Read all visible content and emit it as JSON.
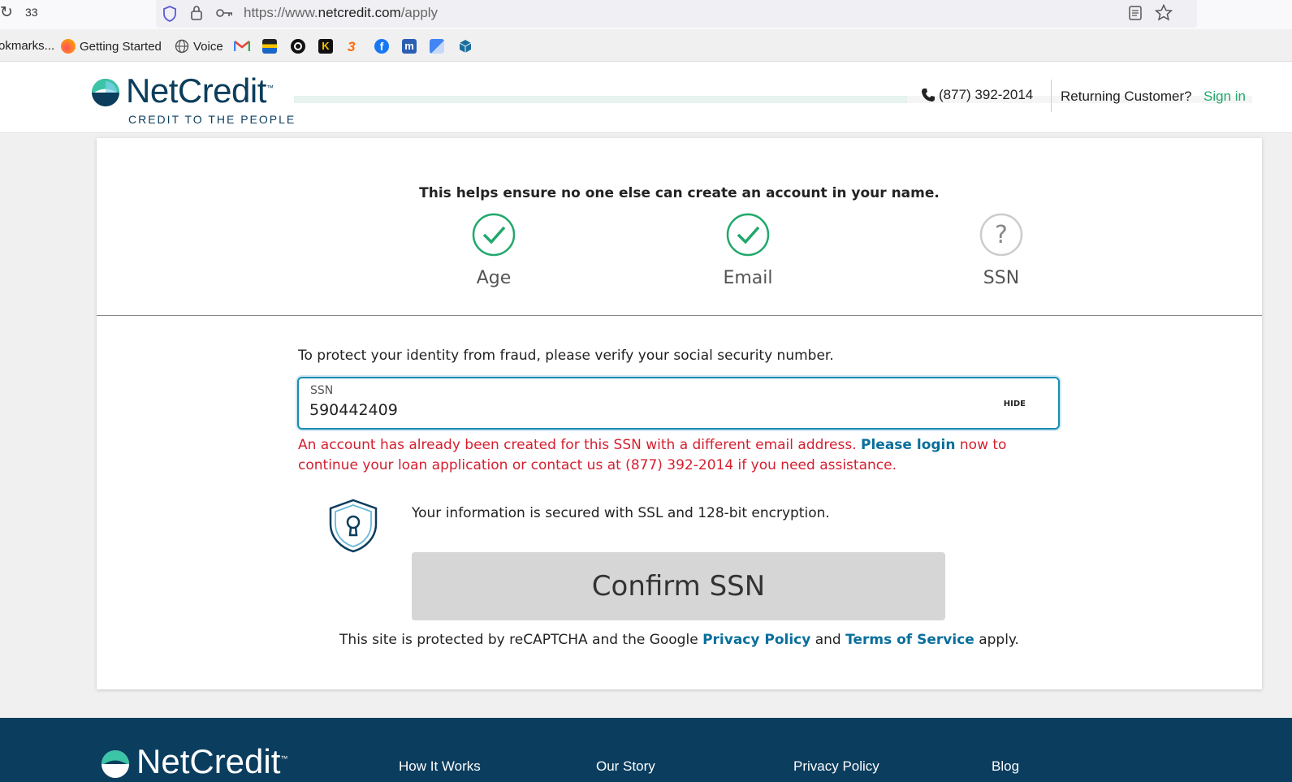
{
  "browser": {
    "tab_count": "33",
    "url_prefix": "https://www.",
    "url_domain": "netcredit.com",
    "url_path": "/apply",
    "bookmarks": [
      {
        "label": "okmarks..."
      },
      {
        "label": "Getting Started"
      },
      {
        "label": "Voice"
      }
    ]
  },
  "header": {
    "logo_text": "NetCredit",
    "logo_tm": "™",
    "tagline": "CREDIT TO THE PEOPLE",
    "progress_percent": 64,
    "phone": "(877) 392-2014",
    "returning_label": "Returning Customer?",
    "signin_label": "Sign in"
  },
  "card": {
    "headline": "This helps ensure no one else can create an account in your name.",
    "steps": [
      {
        "label": "Age",
        "status": "complete"
      },
      {
        "label": "Email",
        "status": "complete"
      },
      {
        "label": "SSN",
        "status": "pending"
      }
    ],
    "instruction": "To protect your identity from fraud, please verify your social security number.",
    "ssn_field": {
      "label": "SSN",
      "value": "590442409",
      "hide_label": "HIDE"
    },
    "error": {
      "before": "An account has already been created for this SSN with a different email address. ",
      "link": "Please login",
      "after": " now to continue your loan application or contact us at (877) 392-2014 if you need assistance."
    },
    "secure_text": "Your information is secured with SSL and 128-bit encryption.",
    "confirm_label": "Confirm SSN",
    "recaptcha": {
      "before": "This site is protected by reCAPTCHA and the Google ",
      "privacy": "Privacy Policy",
      "and": " and ",
      "terms": "Terms of Service",
      "after": " apply."
    }
  },
  "footer": {
    "logo_text": "NetCredit",
    "logo_tm": "™",
    "links": [
      "How It Works",
      "Our Story",
      "Privacy Policy",
      "Blog"
    ]
  },
  "colors": {
    "brand_navy": "#0b3d5c",
    "brand_green": "#20a86b",
    "error_red": "#d51f2f",
    "link_blue": "#0a6f9c",
    "footer_bg": "#0a3d5e"
  }
}
